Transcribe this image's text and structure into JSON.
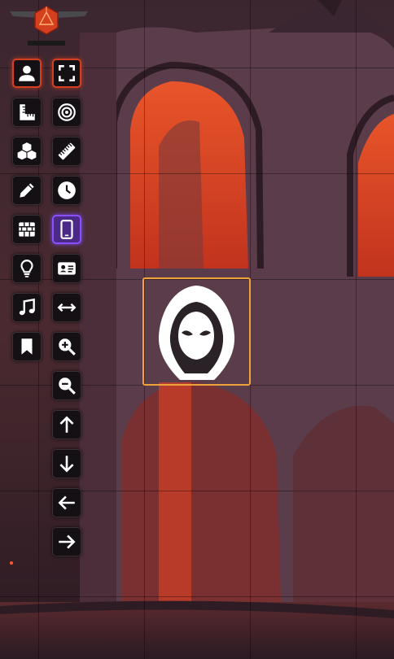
{
  "app": {
    "logo_icon": "d20-dice-logo-icon",
    "accent_red": "#d4401f",
    "accent_purple": "#8a4fff",
    "token_border_color": "#f0a23a"
  },
  "toolbar": {
    "left_column": [
      {
        "icon": "token-controls-icon",
        "active": true
      },
      {
        "icon": "measure-ruler-icon",
        "active": false
      },
      {
        "icon": "tiles-cubes-icon",
        "active": false
      },
      {
        "icon": "drawing-pencil-icon",
        "active": false
      },
      {
        "icon": "walls-bricks-icon",
        "active": false
      },
      {
        "icon": "lighting-bulb-icon",
        "active": false
      },
      {
        "icon": "sounds-music-icon",
        "active": false
      },
      {
        "icon": "notes-bookmark-icon",
        "active": false
      }
    ],
    "right_column": [
      {
        "icon": "select-expand-icon",
        "active": true
      },
      {
        "icon": "target-icon",
        "active": false
      },
      {
        "icon": "ruler-icon",
        "active": false
      },
      {
        "icon": "clock-icon",
        "active": false
      },
      {
        "icon": "mobile-device-icon",
        "active": true
      },
      {
        "icon": "id-card-icon",
        "active": false
      },
      {
        "icon": "resize-horizontal-arrows-icon",
        "active": false
      },
      {
        "icon": "zoom-in-icon",
        "active": false
      },
      {
        "icon": "zoom-out-icon",
        "active": false
      },
      {
        "icon": "pan-up-arrow-icon",
        "active": false
      },
      {
        "icon": "pan-down-arrow-icon",
        "active": false
      },
      {
        "icon": "pan-left-arrow-icon",
        "active": false
      },
      {
        "icon": "pan-right-arrow-icon",
        "active": false
      }
    ]
  },
  "canvas": {
    "token": {
      "icon": "hooded-figure-icon",
      "selected": true
    }
  }
}
